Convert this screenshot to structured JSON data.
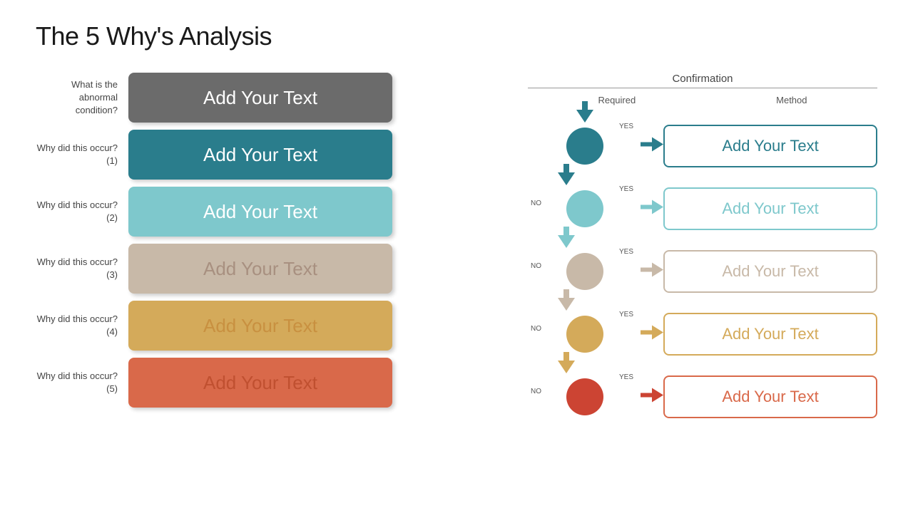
{
  "title": "The 5 Why's Analysis",
  "left": {
    "rows": [
      {
        "label": "What is the abnormal condition?",
        "text": "Add Your Text",
        "boxClass": "box-gray"
      },
      {
        "label": "Why did this occur? (1)",
        "text": "Add Your Text",
        "boxClass": "box-teal"
      },
      {
        "label": "Why did this occur? (2)",
        "text": "Add Your Text",
        "boxClass": "box-ltblue"
      },
      {
        "label": "Why did this occur? (3)",
        "text": "Add Your Text",
        "boxClass": "box-beige"
      },
      {
        "label": "Why did this occur? (4)",
        "text": "Add Your Text",
        "boxClass": "box-gold"
      },
      {
        "label": "Why did this occur? (5)",
        "text": "Add Your Text",
        "boxClass": "box-orange"
      }
    ]
  },
  "right": {
    "confirmation": "Confirmation",
    "col_required": "Required",
    "col_method": "Method",
    "rows": [
      {
        "text": "Add Your Text",
        "circClass": "circ-teal",
        "arrClass": "arr-teal",
        "cbClass": "cb-teal",
        "yesLabel": "YES",
        "noLabel": ""
      },
      {
        "text": "Add Your Text",
        "circClass": "circ-ltblue",
        "arrClass": "arr-ltblue",
        "cbClass": "cb-ltblue",
        "yesLabel": "YES",
        "noLabel": "NO"
      },
      {
        "text": "Add Your Text",
        "circClass": "circ-beige",
        "arrClass": "arr-beige",
        "cbClass": "cb-beige",
        "yesLabel": "YES",
        "noLabel": "NO"
      },
      {
        "text": "Add Your Text",
        "circClass": "circ-gold",
        "arrClass": "arr-gold",
        "cbClass": "cb-gold",
        "yesLabel": "YES",
        "noLabel": "NO"
      },
      {
        "text": "Add Your Text",
        "circClass": "circ-orange",
        "arrClass": "arr-orange",
        "cbClass": "cb-orange",
        "yesLabel": "YES",
        "noLabel": "NO"
      }
    ]
  }
}
